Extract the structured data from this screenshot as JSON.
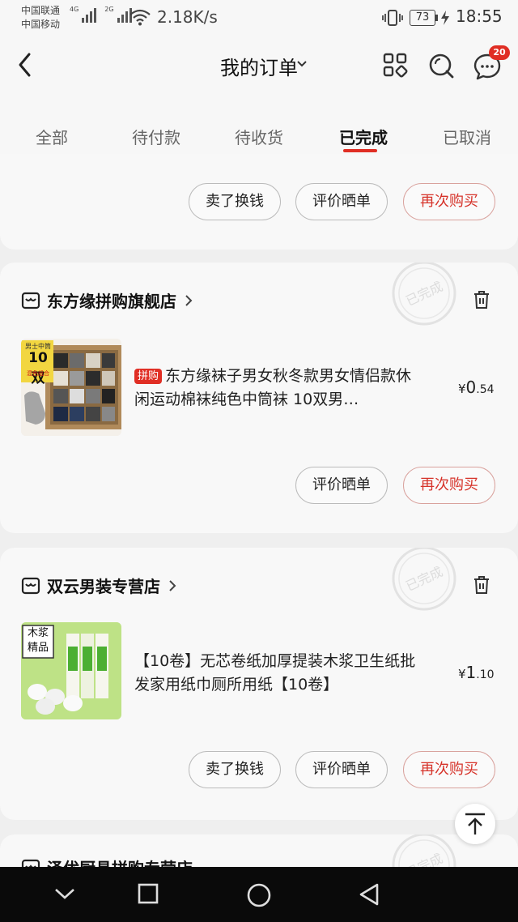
{
  "status_bar": {
    "carrier1": "中国联通",
    "carrier2": "中国移动",
    "net1": "4G",
    "net2": "2G",
    "speed": "2.18K/s",
    "battery": "73",
    "time": "18:55"
  },
  "header": {
    "title": "我的订单",
    "message_badge": "20"
  },
  "tabs": [
    {
      "label": "全部"
    },
    {
      "label": "待付款"
    },
    {
      "label": "待收货"
    },
    {
      "label": "已完成"
    },
    {
      "label": "已取消"
    }
  ],
  "active_tab": "已完成",
  "colors": {
    "accent": "#e02e24"
  },
  "orders": [
    {
      "buttons": [
        "卖了换钱",
        "评价晒单",
        "再次购买"
      ]
    },
    {
      "store": "东方缘拼购旗舰店",
      "tag": "拼购",
      "title": "东方缘袜子男女秋冬款男女情侣款休闲运动棉袜纯色中筒袜 10双男…",
      "price_currency": "¥",
      "price_int": "0",
      "price_dec": ".54",
      "thumb_text": [
        "男士中筒",
        "10双",
        "混色组合"
      ],
      "buttons": [
        "评价晒单",
        "再次购买"
      ]
    },
    {
      "store": "双云男装专营店",
      "title": "【10卷】无芯卷纸加厚提装木浆卫生纸批发家用纸巾厕所用纸【10卷】",
      "price_currency": "¥",
      "price_int": "1",
      "price_dec": ".10",
      "thumb_text": [
        "木浆",
        "精品"
      ],
      "buttons": [
        "卖了换钱",
        "评价晒单",
        "再次购买"
      ]
    },
    {
      "store": "泽优厨具拼购专营店"
    }
  ],
  "stamp_text": "已完成"
}
